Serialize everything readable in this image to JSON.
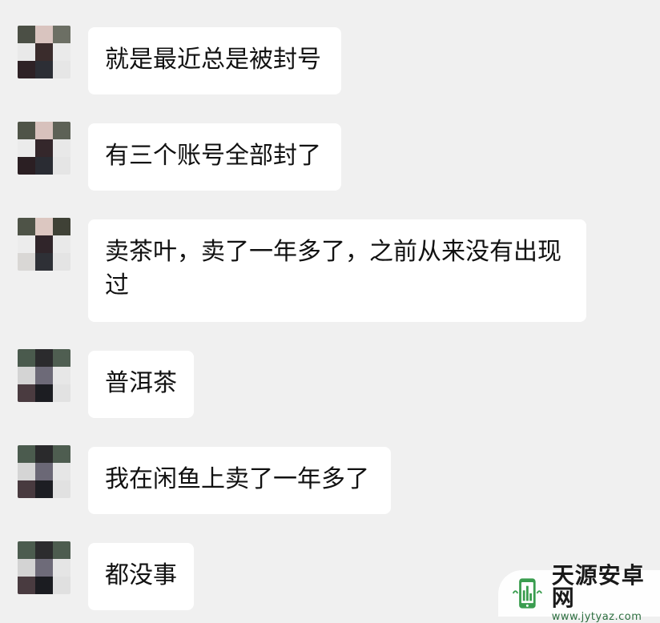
{
  "messages": [
    {
      "text": "就是最近总是被封号",
      "avatar_colors": [
        "#4b4f45",
        "#d9c4bf",
        "#6c6f64",
        "#e9e9e9",
        "#3a2c2c",
        "#eaeaea",
        "#2e2226",
        "#2c2e35",
        "#e6e6e6"
      ]
    },
    {
      "text": "有三个账号全部封了",
      "avatar_colors": [
        "#4f5448",
        "#d7c1bc",
        "#5d6156",
        "#ebebeb",
        "#34272b",
        "#e8e8e8",
        "#2b1f23",
        "#2a2c33",
        "#e5e5e5"
      ]
    },
    {
      "text": "卖茶叶，卖了一年多了，之前从来没有出现过",
      "avatar_colors": [
        "#4e5347",
        "#dcc7c1",
        "#3f4136",
        "#ececec",
        "#30252a",
        "#e9e9e9",
        "#d9d7d5",
        "#2e3036",
        "#e4e4e4"
      ]
    },
    {
      "text": "普洱茶",
      "avatar_colors": [
        "#4a5a4d",
        "#2b2b2d",
        "#4f5e51",
        "#d4d4d4",
        "#6d6a78",
        "#e7e7e7",
        "#4a3b40",
        "#1c1d22",
        "#e2e2e2"
      ]
    },
    {
      "text": "我在闲鱼上卖了一年多了",
      "avatar_colors": [
        "#4b5b4e",
        "#2a2a2c",
        "#4e5d50",
        "#d5d5d5",
        "#6b6876",
        "#e6e6e6",
        "#483a3f",
        "#1d1e23",
        "#e1e1e1"
      ]
    },
    {
      "text": "都没事",
      "avatar_colors": [
        "#4c5c4f",
        "#2c2c2e",
        "#4d5c4f",
        "#d3d3d3",
        "#6e6b79",
        "#e5e5e5",
        "#493b40",
        "#1b1c21",
        "#e0e0e0"
      ]
    }
  ],
  "watermark": {
    "title": "天源安卓网",
    "url": "www.jytyaz.com",
    "logo_icon": "android-phone-logo-icon",
    "accent_color": "#3a9d4f"
  }
}
